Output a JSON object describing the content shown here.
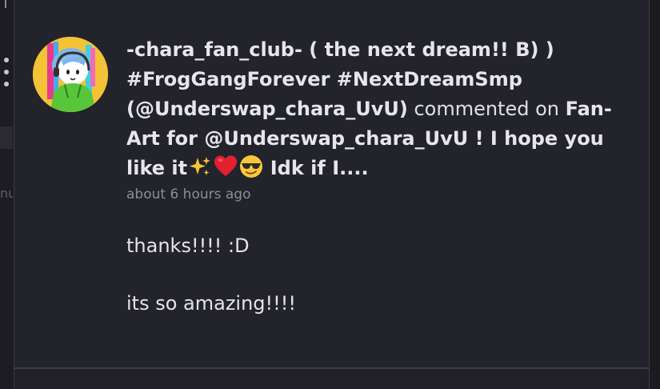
{
  "notification": {
    "actor": "-chara_fan_club- ( the next dream!! B) ) #FrogGangForever #NextDreamSmp (@Underswap_chara_UvU)",
    "action": "commented on",
    "post_title": "Fan-Art for @Underswap_chara_UvU ! I hope you like it",
    "post_title_tail": "Idk if I....",
    "timestamp": "about 6 hours ago",
    "comment_lines": [
      "thanks!!!! :D",
      "its so amazing!!!!"
    ],
    "emojis": [
      "sparkles-emoji",
      "red-heart-emoji",
      "sunglasses-face-emoji"
    ]
  },
  "sidebar_fragment": {
    "text": "nu"
  },
  "colors": {
    "background": "#1b1b20",
    "card": "#23232b",
    "text": "#e6e6ea",
    "muted": "#8d8d94",
    "avatar_bg": "#f4c236"
  }
}
